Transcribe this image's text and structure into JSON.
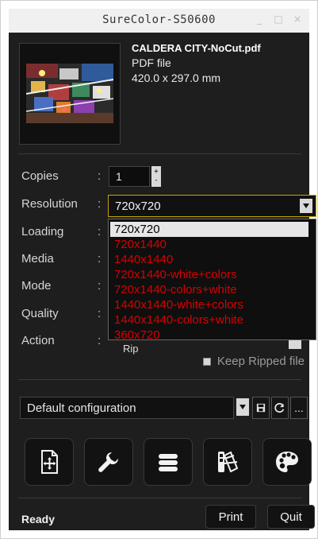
{
  "window": {
    "title": "SureColor-S50600",
    "controls": [
      "_",
      "□",
      "×"
    ]
  },
  "file": {
    "name": "CALDERA CITY-NoCut.pdf",
    "type": "PDF file",
    "size": "420.0 x 297.0 mm"
  },
  "form": {
    "labels": {
      "copies": "Copies",
      "resolution": "Resolution",
      "loading": "Loading",
      "media": "Media",
      "mode": "Mode",
      "quality": "Quality",
      "action": "Action"
    },
    "colon": ":",
    "copies_value": "1",
    "stepper": {
      "up": "+",
      "down": "-"
    },
    "resolution_value": "720x720",
    "resolution_options": [
      "720x720",
      "720x1440",
      "1440x1440",
      "720x1440-white+colors",
      "720x1440-colors+white",
      "1440x1440-white+colors",
      "1440x1440-colors+white",
      "360x720"
    ],
    "action_value_partial": "Rip",
    "keep_ripped_label": "Keep Ripped file"
  },
  "configuration": {
    "value": "Default configuration",
    "more_label": "..."
  },
  "tools": [
    {
      "icon": "add-document-icon"
    },
    {
      "icon": "wrench-icon"
    },
    {
      "icon": "list-icon"
    },
    {
      "icon": "color-swatch-icon"
    },
    {
      "icon": "palette-icon"
    }
  ],
  "footer": {
    "status": "Ready",
    "print": "Print",
    "quit": "Quit"
  },
  "colors": {
    "panel_bg": "#1e1e1e",
    "option_text": "#d80000",
    "selected_bg": "#e6e6e6",
    "focus_border": "#c7a600"
  }
}
